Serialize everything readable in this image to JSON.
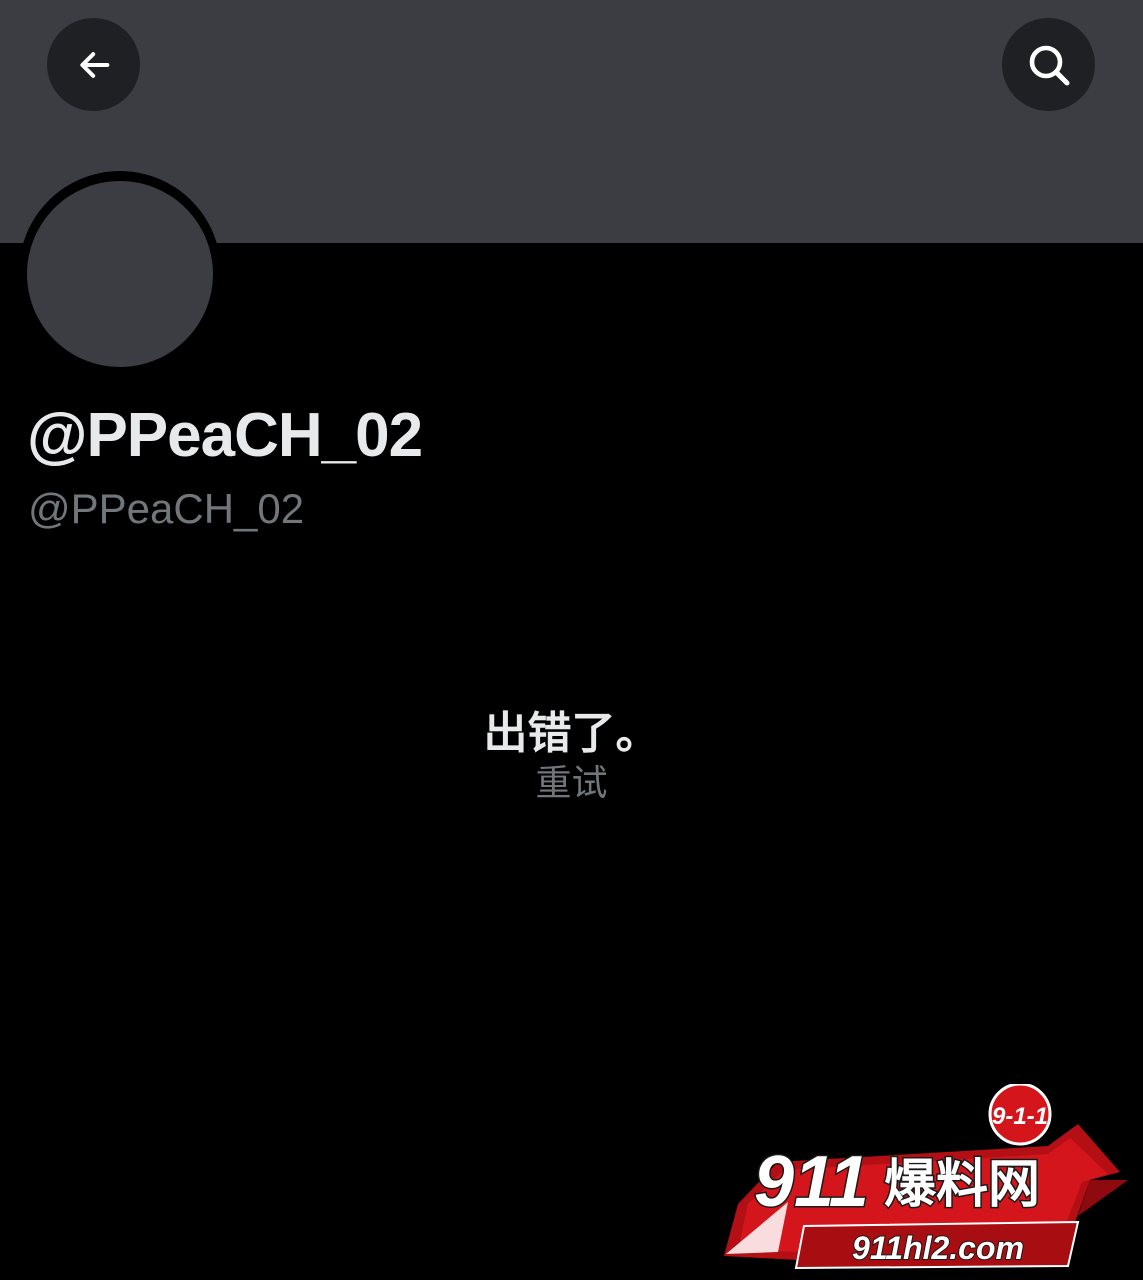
{
  "header": {
    "back_icon": "arrow-left-icon",
    "search_icon": "search-icon"
  },
  "profile": {
    "display_name": "@PPeaCH_02",
    "handle": "@PPeaCH_02"
  },
  "error": {
    "message": "出错了。",
    "retry_label": "重试"
  },
  "watermark": {
    "badge_text": "9-1-1",
    "brand_number": "911",
    "brand_name": "爆料网",
    "url": "911hl2.com"
  },
  "colors": {
    "banner": "#3b3d42",
    "background": "#000000",
    "primary_text": "#e7e9ea",
    "secondary_text": "#71767b",
    "watermark_red": "#d4161c"
  }
}
